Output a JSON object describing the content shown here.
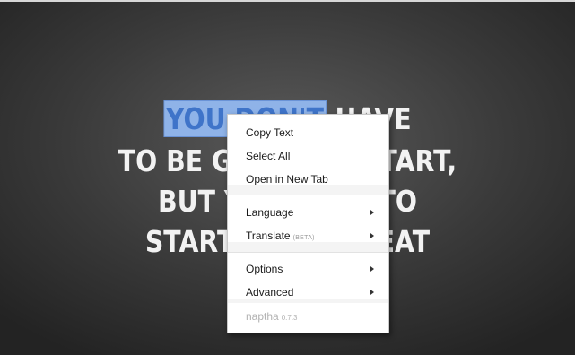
{
  "poster": {
    "line1_highlight": "YOU DON'T",
    "line1_rest": " HAVE",
    "line2": "TO BE GREAT TO START,",
    "line3": "BUT YOU HAVE TO",
    "line4": "START TO BE GREAT"
  },
  "context_menu": {
    "copy_text": "Copy Text",
    "select_all": "Select All",
    "open_new_tab": "Open in New Tab",
    "language": "Language",
    "translate": "Translate",
    "translate_tag": "(BETA)",
    "options": "Options",
    "advanced": "Advanced",
    "footer_name": "naptha",
    "footer_version": "0.7.3"
  },
  "colors": {
    "background": "#3a3a3a",
    "selection_highlight": "#8fb3e8",
    "menu_background": "#ffffff"
  }
}
